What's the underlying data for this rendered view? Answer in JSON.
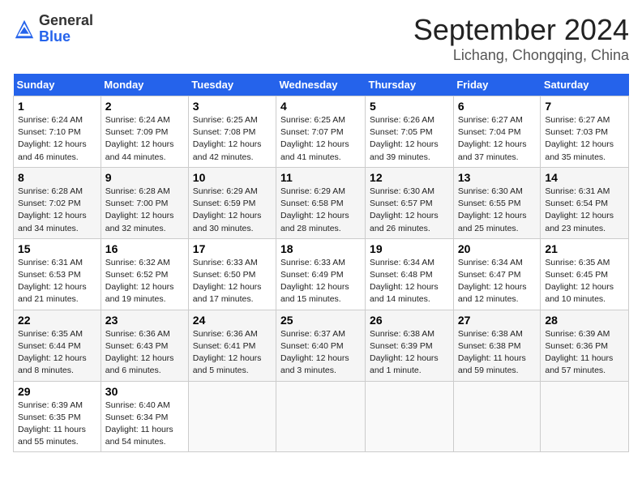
{
  "header": {
    "logo_general": "General",
    "logo_blue": "Blue",
    "month_title": "September 2024",
    "location": "Lichang, Chongqing, China"
  },
  "weekdays": [
    "Sunday",
    "Monday",
    "Tuesday",
    "Wednesday",
    "Thursday",
    "Friday",
    "Saturday"
  ],
  "weeks": [
    [
      {
        "day": "1",
        "sunrise": "6:24 AM",
        "sunset": "7:10 PM",
        "daylight": "12 hours and 46 minutes."
      },
      {
        "day": "2",
        "sunrise": "6:24 AM",
        "sunset": "7:09 PM",
        "daylight": "12 hours and 44 minutes."
      },
      {
        "day": "3",
        "sunrise": "6:25 AM",
        "sunset": "7:08 PM",
        "daylight": "12 hours and 42 minutes."
      },
      {
        "day": "4",
        "sunrise": "6:25 AM",
        "sunset": "7:07 PM",
        "daylight": "12 hours and 41 minutes."
      },
      {
        "day": "5",
        "sunrise": "6:26 AM",
        "sunset": "7:05 PM",
        "daylight": "12 hours and 39 minutes."
      },
      {
        "day": "6",
        "sunrise": "6:27 AM",
        "sunset": "7:04 PM",
        "daylight": "12 hours and 37 minutes."
      },
      {
        "day": "7",
        "sunrise": "6:27 AM",
        "sunset": "7:03 PM",
        "daylight": "12 hours and 35 minutes."
      }
    ],
    [
      {
        "day": "8",
        "sunrise": "6:28 AM",
        "sunset": "7:02 PM",
        "daylight": "12 hours and 34 minutes."
      },
      {
        "day": "9",
        "sunrise": "6:28 AM",
        "sunset": "7:00 PM",
        "daylight": "12 hours and 32 minutes."
      },
      {
        "day": "10",
        "sunrise": "6:29 AM",
        "sunset": "6:59 PM",
        "daylight": "12 hours and 30 minutes."
      },
      {
        "day": "11",
        "sunrise": "6:29 AM",
        "sunset": "6:58 PM",
        "daylight": "12 hours and 28 minutes."
      },
      {
        "day": "12",
        "sunrise": "6:30 AM",
        "sunset": "6:57 PM",
        "daylight": "12 hours and 26 minutes."
      },
      {
        "day": "13",
        "sunrise": "6:30 AM",
        "sunset": "6:55 PM",
        "daylight": "12 hours and 25 minutes."
      },
      {
        "day": "14",
        "sunrise": "6:31 AM",
        "sunset": "6:54 PM",
        "daylight": "12 hours and 23 minutes."
      }
    ],
    [
      {
        "day": "15",
        "sunrise": "6:31 AM",
        "sunset": "6:53 PM",
        "daylight": "12 hours and 21 minutes."
      },
      {
        "day": "16",
        "sunrise": "6:32 AM",
        "sunset": "6:52 PM",
        "daylight": "12 hours and 19 minutes."
      },
      {
        "day": "17",
        "sunrise": "6:33 AM",
        "sunset": "6:50 PM",
        "daylight": "12 hours and 17 minutes."
      },
      {
        "day": "18",
        "sunrise": "6:33 AM",
        "sunset": "6:49 PM",
        "daylight": "12 hours and 15 minutes."
      },
      {
        "day": "19",
        "sunrise": "6:34 AM",
        "sunset": "6:48 PM",
        "daylight": "12 hours and 14 minutes."
      },
      {
        "day": "20",
        "sunrise": "6:34 AM",
        "sunset": "6:47 PM",
        "daylight": "12 hours and 12 minutes."
      },
      {
        "day": "21",
        "sunrise": "6:35 AM",
        "sunset": "6:45 PM",
        "daylight": "12 hours and 10 minutes."
      }
    ],
    [
      {
        "day": "22",
        "sunrise": "6:35 AM",
        "sunset": "6:44 PM",
        "daylight": "12 hours and 8 minutes."
      },
      {
        "day": "23",
        "sunrise": "6:36 AM",
        "sunset": "6:43 PM",
        "daylight": "12 hours and 6 minutes."
      },
      {
        "day": "24",
        "sunrise": "6:36 AM",
        "sunset": "6:41 PM",
        "daylight": "12 hours and 5 minutes."
      },
      {
        "day": "25",
        "sunrise": "6:37 AM",
        "sunset": "6:40 PM",
        "daylight": "12 hours and 3 minutes."
      },
      {
        "day": "26",
        "sunrise": "6:38 AM",
        "sunset": "6:39 PM",
        "daylight": "12 hours and 1 minute."
      },
      {
        "day": "27",
        "sunrise": "6:38 AM",
        "sunset": "6:38 PM",
        "daylight": "11 hours and 59 minutes."
      },
      {
        "day": "28",
        "sunrise": "6:39 AM",
        "sunset": "6:36 PM",
        "daylight": "11 hours and 57 minutes."
      }
    ],
    [
      {
        "day": "29",
        "sunrise": "6:39 AM",
        "sunset": "6:35 PM",
        "daylight": "11 hours and 55 minutes."
      },
      {
        "day": "30",
        "sunrise": "6:40 AM",
        "sunset": "6:34 PM",
        "daylight": "11 hours and 54 minutes."
      },
      null,
      null,
      null,
      null,
      null
    ]
  ]
}
